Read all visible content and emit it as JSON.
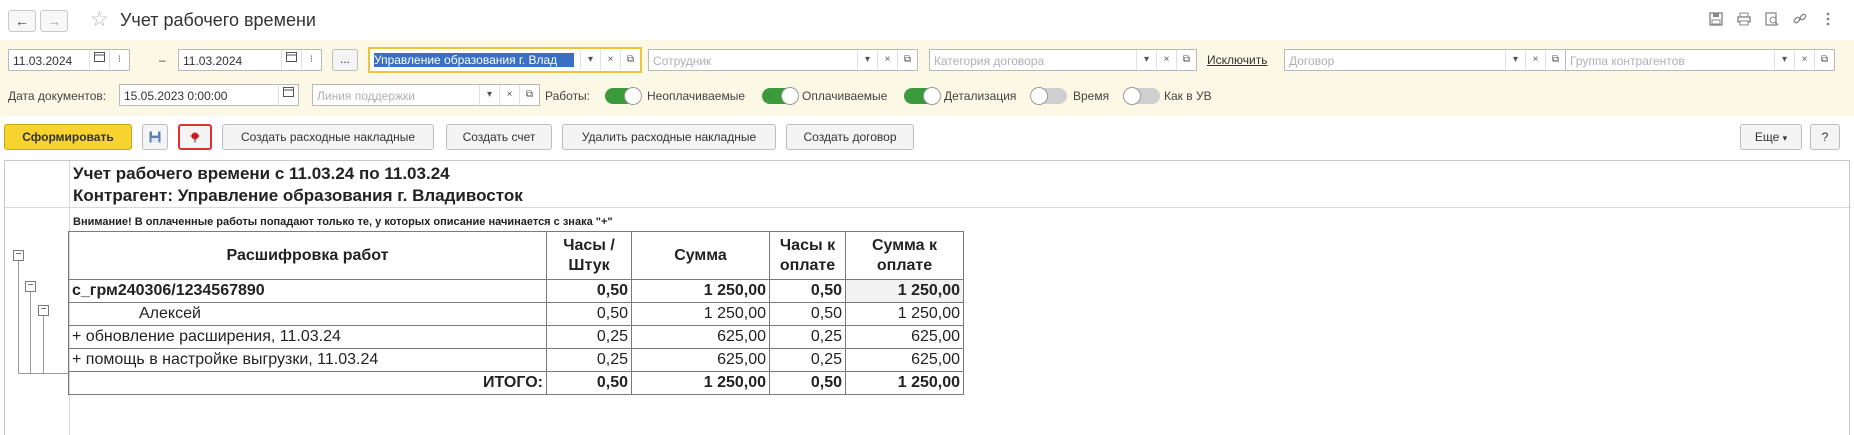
{
  "window": {
    "title": "Учет рабочего времени",
    "back_icon": "←",
    "forward_icon": "→",
    "star_icon": "☆",
    "icons": [
      "save-icon",
      "print-icon",
      "preview-icon",
      "link-icon",
      "more-icon"
    ]
  },
  "filters": {
    "date_from": "11.03.2024",
    "dash": "–",
    "date_to": "11.03.2024",
    "ellipsis": "...",
    "counterparty": "Управление образования г. Влад",
    "employee_placeholder": "Сотрудник",
    "contract_category_placeholder": "Категория договора",
    "exclude_link": "Исключить",
    "contract_placeholder": "Договор",
    "counterparty_group_placeholder": "Группа контрагентов",
    "documents_date_label": "Дата документов:",
    "documents_date": "15.05.2023  0:00:00",
    "support_line_placeholder": "Линия поддержки",
    "works_label": "Работы:",
    "toggles": [
      {
        "label": "Неоплачиваемые",
        "on": true
      },
      {
        "label": "Оплачиваемые",
        "on": true
      },
      {
        "label": "Детализация",
        "on": true
      },
      {
        "label": "Время",
        "on": false
      },
      {
        "label": "Как в УВ",
        "on": false
      }
    ]
  },
  "toolbar": {
    "generate": "Сформировать",
    "create_expense_invoices": "Создать расходные накладные",
    "create_invoice": "Создать счет",
    "delete_expense_invoices": "Удалить расходные накладные",
    "create_contract": "Создать договор",
    "more": "Еще",
    "help": "?"
  },
  "report": {
    "title": "Учет рабочего времени с 11.03.24 по 11.03.24",
    "counterparty": "Контрагент: Управление образования г. Владивосток",
    "warning": "Внимание! В оплаченные работы попадают только те, у которых описание начинается с знака \"+\"",
    "columns": {
      "work": "Расшифровка работ",
      "hours_1": "Часы /",
      "hours_2": "Штук",
      "sum": "Сумма",
      "hours_pay_1": "Часы к",
      "hours_pay_2": "оплате",
      "sum_pay_1": "Сумма к",
      "sum_pay_2": "оплате"
    },
    "rows": [
      {
        "name": "с_грм240306/1234567890",
        "hours": "0,50",
        "sum": "1 250,00",
        "hours_pay": "0,50",
        "sum_pay": "1 250,00"
      },
      {
        "name": "Алексей",
        "hours": "0,50",
        "sum": "1 250,00",
        "hours_pay": "0,50",
        "sum_pay": "1 250,00"
      },
      {
        "name": "+ обновление расширения, 11.03.24",
        "hours": "0,25",
        "sum": "625,00",
        "hours_pay": "0,25",
        "sum_pay": "625,00"
      },
      {
        "name": "+ помощь в настройке выгрузки, 11.03.24",
        "hours": "0,25",
        "sum": "625,00",
        "hours_pay": "0,25",
        "sum_pay": "625,00"
      }
    ],
    "total": {
      "label": "ИТОГО:",
      "hours": "0,50",
      "sum": "1 250,00",
      "hours_pay": "0,50",
      "sum_pay": "1 250,00"
    },
    "group_minus": "−"
  }
}
